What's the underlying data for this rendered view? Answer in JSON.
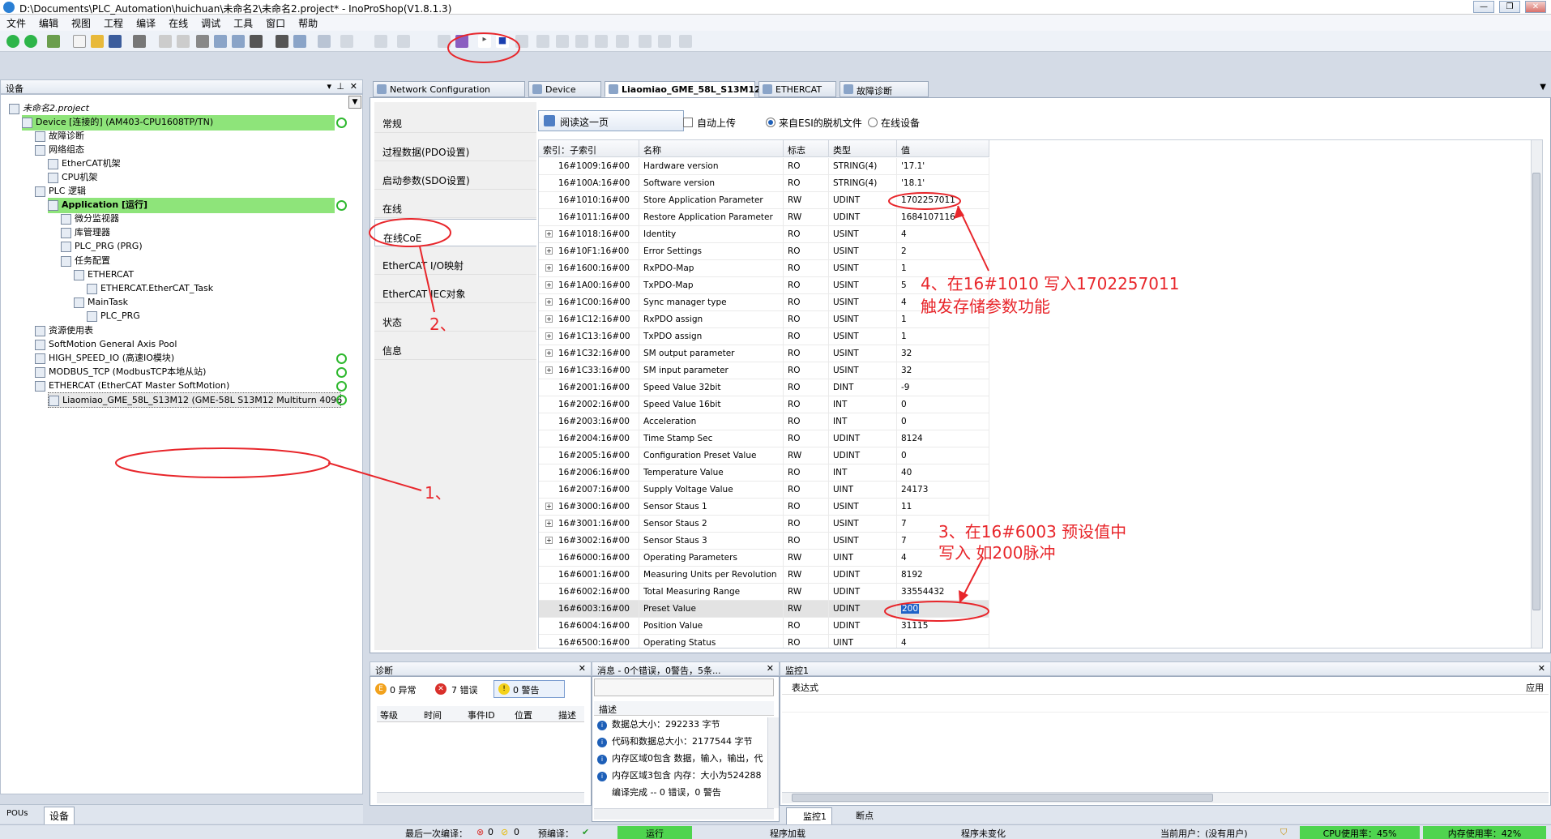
{
  "window": {
    "title": "D:\\Documents\\PLC_Automation\\huichuan\\未命名2\\未命名2.project* - InoProShop(V1.8.1.3)",
    "buttons": [
      "—",
      "❐",
      "✕"
    ]
  },
  "menu": [
    "文件",
    "编辑",
    "视图",
    "工程",
    "编译",
    "在线",
    "调试",
    "工具",
    "窗口",
    "帮助"
  ],
  "left_pane": {
    "title": "设备",
    "tree": [
      {
        "label": "未命名2.project",
        "indent": 0,
        "italic": true
      },
      {
        "label": "Device [连接的] (AM403-CPU1608TP/TN)",
        "indent": 1,
        "highlight": true,
        "status": "ok"
      },
      {
        "label": "故障诊断",
        "indent": 2
      },
      {
        "label": "网络组态",
        "indent": 2
      },
      {
        "label": "EtherCAT机架",
        "indent": 3
      },
      {
        "label": "CPU机架",
        "indent": 3
      },
      {
        "label": "PLC 逻辑",
        "indent": 2
      },
      {
        "label": "Application [运行]",
        "indent": 3,
        "highlight": true,
        "bold": true,
        "status": "ok"
      },
      {
        "label": "微分监视器",
        "indent": 4
      },
      {
        "label": "库管理器",
        "indent": 4
      },
      {
        "label": "PLC_PRG (PRG)",
        "indent": 4
      },
      {
        "label": "任务配置",
        "indent": 4
      },
      {
        "label": "ETHERCAT",
        "indent": 5
      },
      {
        "label": "ETHERCAT.EtherCAT_Task",
        "indent": 6
      },
      {
        "label": "MainTask",
        "indent": 5
      },
      {
        "label": "PLC_PRG",
        "indent": 6
      },
      {
        "label": "资源使用表",
        "indent": 2
      },
      {
        "label": "SoftMotion General Axis Pool",
        "indent": 2
      },
      {
        "label": "HIGH_SPEED_IO (高速IO模块)",
        "indent": 2,
        "status": "ok"
      },
      {
        "label": "MODBUS_TCP (ModbusTCP本地从站)",
        "indent": 2,
        "status": "ok"
      },
      {
        "label": "ETHERCAT (EtherCAT Master SoftMotion)",
        "indent": 2,
        "status": "ok"
      },
      {
        "label": "Liaomiao_GME_58L_S13M12 (GME-58L S13M12 Multiturn 4096",
        "indent": 3,
        "status": "ok",
        "selected": true
      }
    ],
    "bottom_tabs": [
      "POUs",
      "设备"
    ]
  },
  "tabs": [
    {
      "label": "Network Configuration"
    },
    {
      "label": "Device"
    },
    {
      "label": "Liaomiao_GME_58L_S13M12",
      "active": true,
      "close": "✕"
    },
    {
      "label": "ETHERCAT"
    },
    {
      "label": "故障诊断"
    }
  ],
  "side_nav": [
    "常规",
    "过程数据(PDO设置)",
    "启动参数(SDO设置)",
    "在线",
    "在线CoE",
    "EtherCAT I/O映射",
    "EtherCAT IEC对象",
    "状态",
    "信息"
  ],
  "coe": {
    "read_button": "阅读这一页",
    "auto_upload": "自动上传",
    "radio_esi": "来自ESI的脱机文件",
    "radio_online": "在线设备",
    "columns": [
      "索引：子索引",
      "名称",
      "标志",
      "类型",
      "值"
    ],
    "rows": [
      {
        "idx": "16#1009:16#00",
        "name": "Hardware version",
        "flag": "RO",
        "type": "STRING(4)",
        "value": "'17.1'"
      },
      {
        "idx": "16#100A:16#00",
        "name": "Software version",
        "flag": "RO",
        "type": "STRING(4)",
        "value": "'18.1'"
      },
      {
        "idx": "16#1010:16#00",
        "name": "Store Application Parameter",
        "flag": "RW",
        "type": "UDINT",
        "value": "1702257011"
      },
      {
        "idx": "16#1011:16#00",
        "name": "Restore Application Parameter",
        "flag": "RW",
        "type": "UDINT",
        "value": "1684107116"
      },
      {
        "idx": "16#1018:16#00",
        "name": "Identity",
        "flag": "RO",
        "type": "USINT",
        "value": "4",
        "plus": true
      },
      {
        "idx": "16#10F1:16#00",
        "name": "Error Settings",
        "flag": "RO",
        "type": "USINT",
        "value": "2",
        "plus": true
      },
      {
        "idx": "16#1600:16#00",
        "name": "RxPDO-Map",
        "flag": "RO",
        "type": "USINT",
        "value": "1",
        "plus": true
      },
      {
        "idx": "16#1A00:16#00",
        "name": "TxPDO-Map",
        "flag": "RO",
        "type": "USINT",
        "value": "5",
        "plus": true
      },
      {
        "idx": "16#1C00:16#00",
        "name": "Sync manager type",
        "flag": "RO",
        "type": "USINT",
        "value": "4",
        "plus": true
      },
      {
        "idx": "16#1C12:16#00",
        "name": "RxPDO assign",
        "flag": "RO",
        "type": "USINT",
        "value": "1",
        "plus": true
      },
      {
        "idx": "16#1C13:16#00",
        "name": "TxPDO assign",
        "flag": "RO",
        "type": "USINT",
        "value": "1",
        "plus": true
      },
      {
        "idx": "16#1C32:16#00",
        "name": "SM output parameter",
        "flag": "RO",
        "type": "USINT",
        "value": "32",
        "plus": true
      },
      {
        "idx": "16#1C33:16#00",
        "name": "SM input parameter",
        "flag": "RO",
        "type": "USINT",
        "value": "32",
        "plus": true
      },
      {
        "idx": "16#2001:16#00",
        "name": "Speed Value 32bit",
        "flag": "RO",
        "type": "DINT",
        "value": "-9"
      },
      {
        "idx": "16#2002:16#00",
        "name": "Speed Value 16bit",
        "flag": "RO",
        "type": "INT",
        "value": "0"
      },
      {
        "idx": "16#2003:16#00",
        "name": "Acceleration",
        "flag": "RO",
        "type": "INT",
        "value": "0"
      },
      {
        "idx": "16#2004:16#00",
        "name": "Time Stamp Sec",
        "flag": "RO",
        "type": "UDINT",
        "value": "8124"
      },
      {
        "idx": "16#2005:16#00",
        "name": "Configuration Preset Value",
        "flag": "RW",
        "type": "UDINT",
        "value": "0"
      },
      {
        "idx": "16#2006:16#00",
        "name": "Temperature Value",
        "flag": "RO",
        "type": "INT",
        "value": "40"
      },
      {
        "idx": "16#2007:16#00",
        "name": "Supply Voltage Value",
        "flag": "RO",
        "type": "UINT",
        "value": "24173"
      },
      {
        "idx": "16#3000:16#00",
        "name": "Sensor Staus 1",
        "flag": "RO",
        "type": "USINT",
        "value": "11",
        "plus": true
      },
      {
        "idx": "16#3001:16#00",
        "name": "Sensor Staus 2",
        "flag": "RO",
        "type": "USINT",
        "value": "7",
        "plus": true
      },
      {
        "idx": "16#3002:16#00",
        "name": "Sensor Staus 3",
        "flag": "RO",
        "type": "USINT",
        "value": "7",
        "plus": true
      },
      {
        "idx": "16#6000:16#00",
        "name": "Operating Parameters",
        "flag": "RW",
        "type": "UINT",
        "value": "4"
      },
      {
        "idx": "16#6001:16#00",
        "name": "Measuring Units per Revolution",
        "flag": "RW",
        "type": "UDINT",
        "value": "8192"
      },
      {
        "idx": "16#6002:16#00",
        "name": "Total Measuring Range",
        "flag": "RW",
        "type": "UDINT",
        "value": "33554432"
      },
      {
        "idx": "16#6003:16#00",
        "name": "Preset Value",
        "flag": "RW",
        "type": "UDINT",
        "value": "200",
        "selected": true,
        "editing": true
      },
      {
        "idx": "16#6004:16#00",
        "name": "Position Value",
        "flag": "RO",
        "type": "UDINT",
        "value": "31115"
      },
      {
        "idx": "16#6500:16#00",
        "name": "Operating Status",
        "flag": "RO",
        "type": "UINT",
        "value": "4"
      }
    ]
  },
  "diag_pane": {
    "title": "诊断",
    "badges": [
      "0 异常",
      "7 错误",
      "0 警告"
    ],
    "columns": [
      "等级",
      "时间",
      "事件ID",
      "位置",
      "描述"
    ]
  },
  "msg_pane": {
    "title": "消息 - 0个错误，0警告，5条...",
    "column": "描述",
    "items": [
      "数据总大小：292233 字节",
      "代码和数据总大小：2177544 字节",
      "内存区域0包含 数据，输入，输出，代",
      "内存区域3包含 内存：大小为524288",
      "编译完成 -- 0 错误，0 警告"
    ]
  },
  "watch_pane": {
    "title": "监控1",
    "col_expr": "表达式",
    "col_apply": "应用",
    "tabs": [
      "监控1",
      "断点"
    ]
  },
  "statusbar": {
    "last_compile": "最后一次编译：",
    "err": "0",
    "warn": "0",
    "precompile": "预编译：",
    "run": "运行",
    "prog_load": "程序加载",
    "prog_unchanged": "程序未变化",
    "user": "当前用户：(没有用户)",
    "cpu": "CPU使用率：45%",
    "mem": "内存使用率：42%"
  },
  "annotations": {
    "a1": "1、",
    "a2": "2、",
    "a3_line1": "3、在16#6003 预设值中",
    "a3_line2": "写入 如200脉冲",
    "a4_line1": "4、在16#1010 写入1702257011",
    "a4_line2": "触发存储参数功能"
  },
  "colors": {
    "annotation": "#e8262b",
    "highlight": "#8ee47a",
    "status_green": "#4fd44f"
  }
}
